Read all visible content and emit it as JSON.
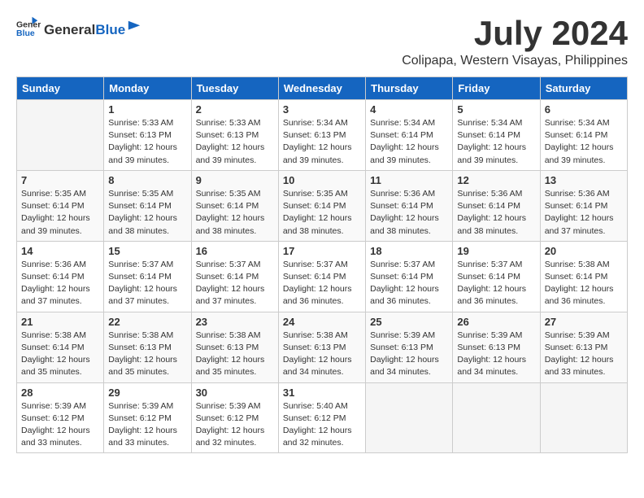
{
  "header": {
    "logo_general": "General",
    "logo_blue": "Blue",
    "month_year": "July 2024",
    "location": "Colipapa, Western Visayas, Philippines"
  },
  "days_of_week": [
    "Sunday",
    "Monday",
    "Tuesday",
    "Wednesday",
    "Thursday",
    "Friday",
    "Saturday"
  ],
  "weeks": [
    [
      {
        "day": "",
        "info": ""
      },
      {
        "day": "1",
        "info": "Sunrise: 5:33 AM\nSunset: 6:13 PM\nDaylight: 12 hours\nand 39 minutes."
      },
      {
        "day": "2",
        "info": "Sunrise: 5:33 AM\nSunset: 6:13 PM\nDaylight: 12 hours\nand 39 minutes."
      },
      {
        "day": "3",
        "info": "Sunrise: 5:34 AM\nSunset: 6:13 PM\nDaylight: 12 hours\nand 39 minutes."
      },
      {
        "day": "4",
        "info": "Sunrise: 5:34 AM\nSunset: 6:14 PM\nDaylight: 12 hours\nand 39 minutes."
      },
      {
        "day": "5",
        "info": "Sunrise: 5:34 AM\nSunset: 6:14 PM\nDaylight: 12 hours\nand 39 minutes."
      },
      {
        "day": "6",
        "info": "Sunrise: 5:34 AM\nSunset: 6:14 PM\nDaylight: 12 hours\nand 39 minutes."
      }
    ],
    [
      {
        "day": "7",
        "info": "Sunrise: 5:35 AM\nSunset: 6:14 PM\nDaylight: 12 hours\nand 39 minutes."
      },
      {
        "day": "8",
        "info": "Sunrise: 5:35 AM\nSunset: 6:14 PM\nDaylight: 12 hours\nand 38 minutes."
      },
      {
        "day": "9",
        "info": "Sunrise: 5:35 AM\nSunset: 6:14 PM\nDaylight: 12 hours\nand 38 minutes."
      },
      {
        "day": "10",
        "info": "Sunrise: 5:35 AM\nSunset: 6:14 PM\nDaylight: 12 hours\nand 38 minutes."
      },
      {
        "day": "11",
        "info": "Sunrise: 5:36 AM\nSunset: 6:14 PM\nDaylight: 12 hours\nand 38 minutes."
      },
      {
        "day": "12",
        "info": "Sunrise: 5:36 AM\nSunset: 6:14 PM\nDaylight: 12 hours\nand 38 minutes."
      },
      {
        "day": "13",
        "info": "Sunrise: 5:36 AM\nSunset: 6:14 PM\nDaylight: 12 hours\nand 37 minutes."
      }
    ],
    [
      {
        "day": "14",
        "info": "Sunrise: 5:36 AM\nSunset: 6:14 PM\nDaylight: 12 hours\nand 37 minutes."
      },
      {
        "day": "15",
        "info": "Sunrise: 5:37 AM\nSunset: 6:14 PM\nDaylight: 12 hours\nand 37 minutes."
      },
      {
        "day": "16",
        "info": "Sunrise: 5:37 AM\nSunset: 6:14 PM\nDaylight: 12 hours\nand 37 minutes."
      },
      {
        "day": "17",
        "info": "Sunrise: 5:37 AM\nSunset: 6:14 PM\nDaylight: 12 hours\nand 36 minutes."
      },
      {
        "day": "18",
        "info": "Sunrise: 5:37 AM\nSunset: 6:14 PM\nDaylight: 12 hours\nand 36 minutes."
      },
      {
        "day": "19",
        "info": "Sunrise: 5:37 AM\nSunset: 6:14 PM\nDaylight: 12 hours\nand 36 minutes."
      },
      {
        "day": "20",
        "info": "Sunrise: 5:38 AM\nSunset: 6:14 PM\nDaylight: 12 hours\nand 36 minutes."
      }
    ],
    [
      {
        "day": "21",
        "info": "Sunrise: 5:38 AM\nSunset: 6:14 PM\nDaylight: 12 hours\nand 35 minutes."
      },
      {
        "day": "22",
        "info": "Sunrise: 5:38 AM\nSunset: 6:13 PM\nDaylight: 12 hours\nand 35 minutes."
      },
      {
        "day": "23",
        "info": "Sunrise: 5:38 AM\nSunset: 6:13 PM\nDaylight: 12 hours\nand 35 minutes."
      },
      {
        "day": "24",
        "info": "Sunrise: 5:38 AM\nSunset: 6:13 PM\nDaylight: 12 hours\nand 34 minutes."
      },
      {
        "day": "25",
        "info": "Sunrise: 5:39 AM\nSunset: 6:13 PM\nDaylight: 12 hours\nand 34 minutes."
      },
      {
        "day": "26",
        "info": "Sunrise: 5:39 AM\nSunset: 6:13 PM\nDaylight: 12 hours\nand 34 minutes."
      },
      {
        "day": "27",
        "info": "Sunrise: 5:39 AM\nSunset: 6:13 PM\nDaylight: 12 hours\nand 33 minutes."
      }
    ],
    [
      {
        "day": "28",
        "info": "Sunrise: 5:39 AM\nSunset: 6:12 PM\nDaylight: 12 hours\nand 33 minutes."
      },
      {
        "day": "29",
        "info": "Sunrise: 5:39 AM\nSunset: 6:12 PM\nDaylight: 12 hours\nand 33 minutes."
      },
      {
        "day": "30",
        "info": "Sunrise: 5:39 AM\nSunset: 6:12 PM\nDaylight: 12 hours\nand 32 minutes."
      },
      {
        "day": "31",
        "info": "Sunrise: 5:40 AM\nSunset: 6:12 PM\nDaylight: 12 hours\nand 32 minutes."
      },
      {
        "day": "",
        "info": ""
      },
      {
        "day": "",
        "info": ""
      },
      {
        "day": "",
        "info": ""
      }
    ]
  ]
}
